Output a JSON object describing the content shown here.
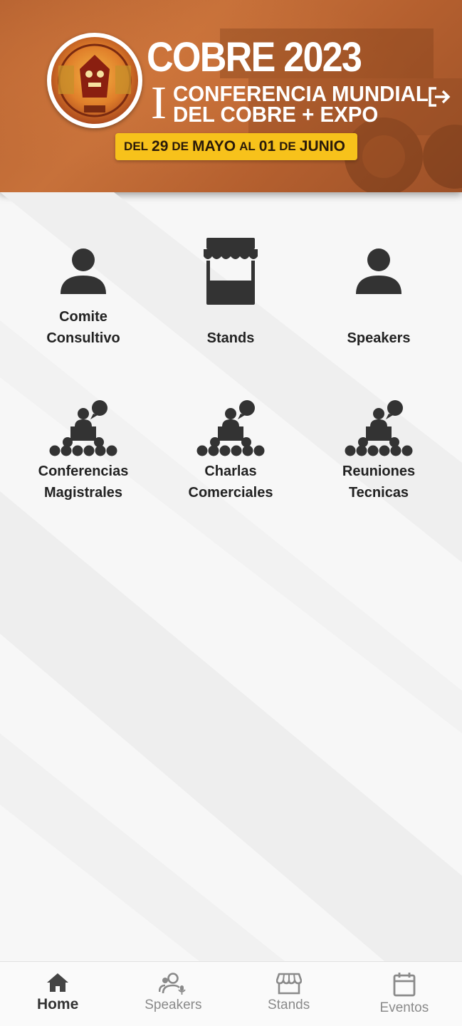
{
  "header": {
    "title": "COBRE 2023",
    "roman": "I",
    "subtitle_line1": "CONFERENCIA MUNDIAL",
    "subtitle_line2": "DEL COBRE + EXPO",
    "date": {
      "del": "DEL",
      "day1": "29",
      "de1": "DE",
      "month1": "MAYO",
      "al": "AL",
      "day2": "01",
      "de2": "DE",
      "month2": "JUNIO"
    },
    "logout_icon": "logout-icon"
  },
  "menu": [
    {
      "label": "Comite Consultivo",
      "line1": "Comite",
      "line2": "Consultivo",
      "icon": "person-icon"
    },
    {
      "label": "Stands",
      "line1": "",
      "line2": "Stands",
      "icon": "stand-icon"
    },
    {
      "label": "Speakers",
      "line1": "",
      "line2": "Speakers",
      "icon": "person-icon"
    },
    {
      "label": "Conferencias Magistrales",
      "line1": "Conferencias",
      "line2": "Magistrales",
      "icon": "audience-speaker-icon"
    },
    {
      "label": "Charlas Comerciales",
      "line1": "Charlas",
      "line2": "Comerciales",
      "icon": "audience-speaker-icon"
    },
    {
      "label": "Reuniones Tecnicas",
      "line1": "Reuniones",
      "line2": "Tecnicas",
      "icon": "audience-speaker-icon"
    }
  ],
  "bottom_nav": [
    {
      "label": "Home",
      "icon": "home-icon",
      "active": true
    },
    {
      "label": "Speakers",
      "icon": "speakers-icon",
      "active": false
    },
    {
      "label": "Stands",
      "icon": "store-icon",
      "active": false
    },
    {
      "label": "Eventos",
      "icon": "calendar-icon",
      "active": false
    }
  ],
  "colors": {
    "banner": "#c06a35",
    "date_pill": "#f7c21b",
    "icon_dark": "#333333",
    "nav_inactive": "#8a8a8a"
  }
}
